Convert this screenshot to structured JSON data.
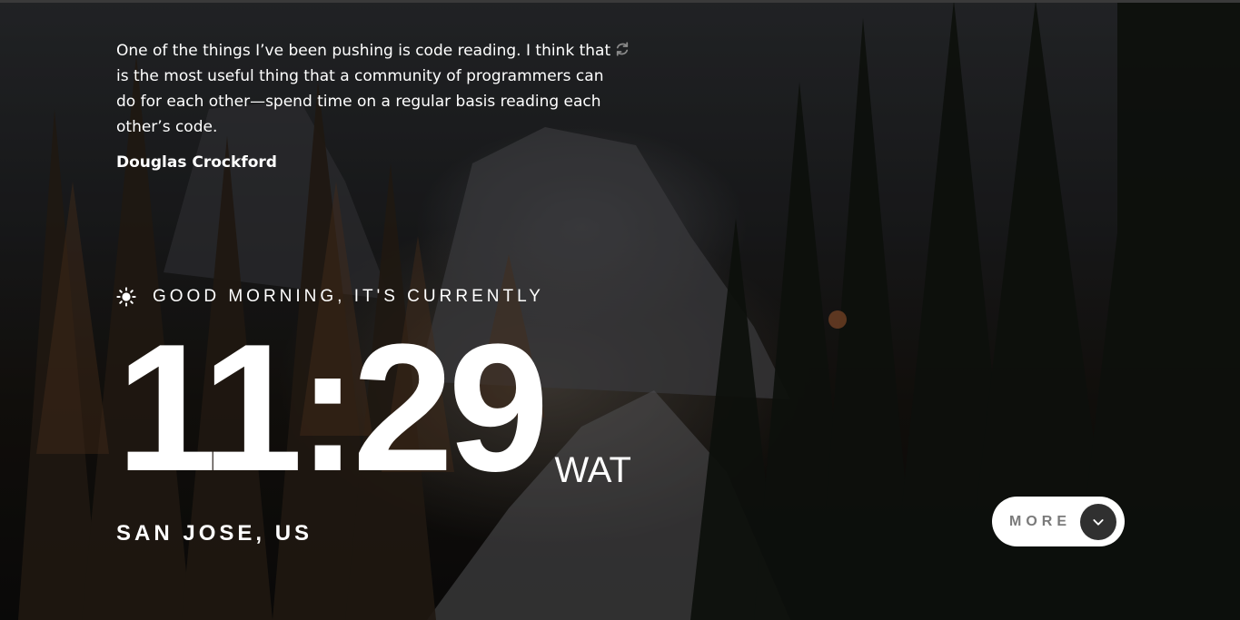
{
  "quote": {
    "text": "One of the things I’ve been pushing is code reading. I think that is the most useful thing that a community of programmers can do for each other—spend time on a regular basis reading each other’s code.",
    "author": "Douglas Crockford",
    "refresh_icon": "refresh-icon"
  },
  "greeting": {
    "icon": "sun-icon",
    "text": "GOOD MORNING, IT'S CURRENTLY"
  },
  "clock": {
    "time": "11:29",
    "timezone": "WAT"
  },
  "location": "SAN JOSE, US",
  "more_button": {
    "label": "MORE",
    "icon": "chevron-down-icon"
  },
  "colors": {
    "text": "#ffffff",
    "button_bg": "#ffffff",
    "button_label": "#7a7a7a",
    "button_circle": "#303030"
  }
}
